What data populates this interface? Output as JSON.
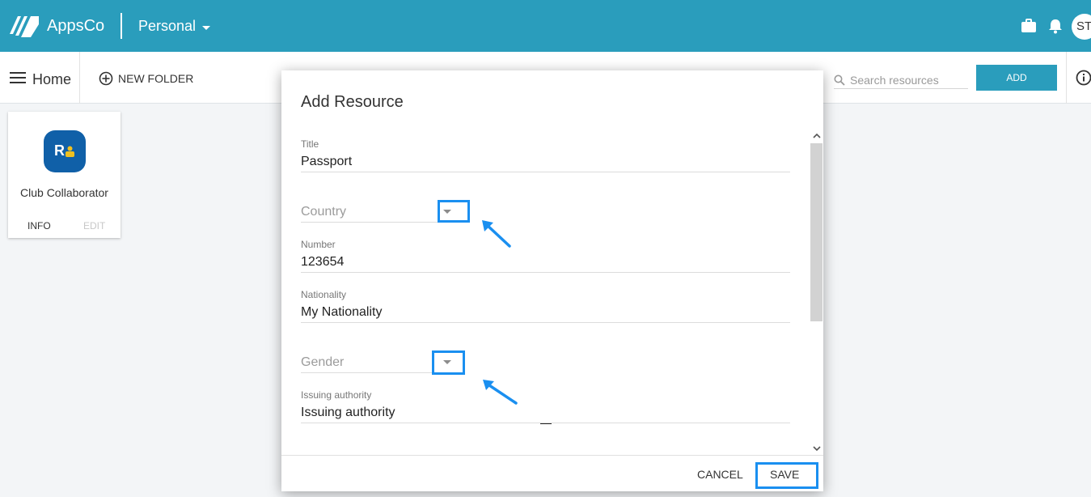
{
  "header": {
    "brand": "AppsCo",
    "workspace": "Personal",
    "avatar_initials": "ST"
  },
  "toolbar": {
    "home_label": "Home",
    "new_folder_label": "NEW FOLDER",
    "search_placeholder": "Search resources",
    "add_label": "ADD"
  },
  "card": {
    "app_name": "Club Collaborator",
    "info_label": "INFO",
    "edit_label": "EDIT"
  },
  "dialog": {
    "title": "Add Resource",
    "fields": {
      "title": {
        "label": "Title",
        "value": "Passport"
      },
      "country": {
        "placeholder": "Country"
      },
      "number": {
        "label": "Number",
        "value": "123654"
      },
      "nationality": {
        "label": "Nationality",
        "value": "My Nationality"
      },
      "gender": {
        "placeholder": "Gender"
      },
      "issuing_authority": {
        "label": "Issuing authority",
        "value": "Issuing authority"
      }
    },
    "cancel_label": "CANCEL",
    "save_label": "SAVE"
  },
  "colors": {
    "brand": "#2a9dbc",
    "highlight": "#1a8ff0"
  }
}
